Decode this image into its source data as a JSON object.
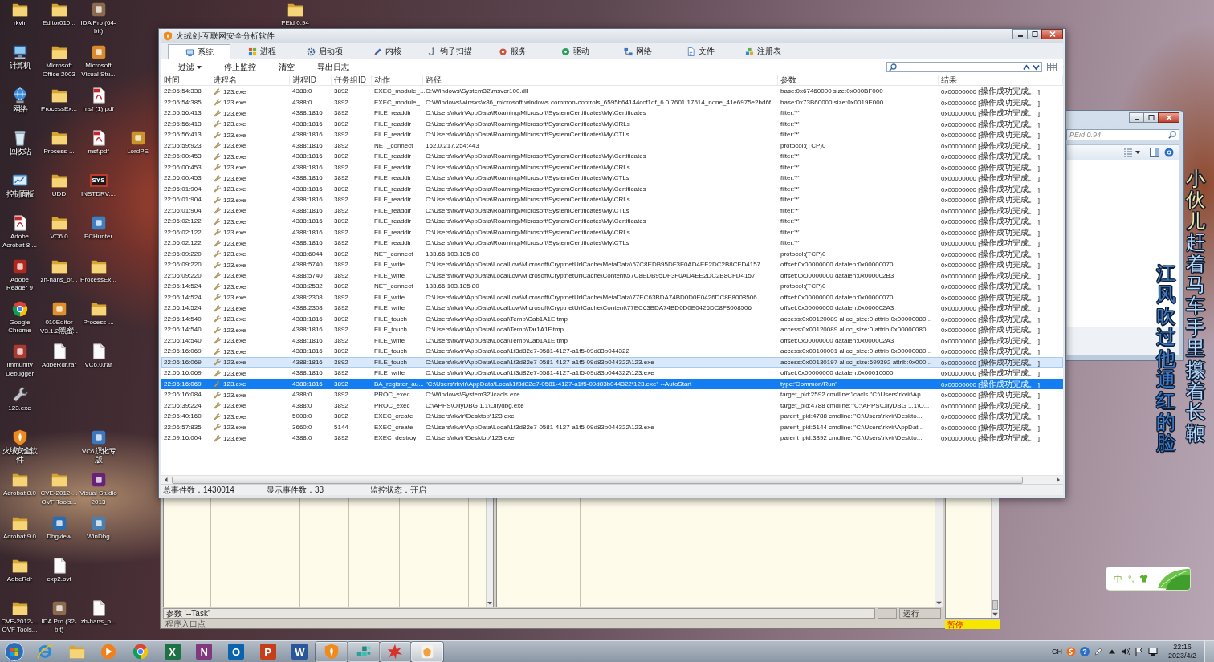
{
  "desktop_icon_rows": [
    [
      {
        "label": "rkvir",
        "kind": "folder"
      },
      {
        "label": "Editor010...",
        "kind": "folder"
      },
      {
        "label": "IDA Pro (64-bit)",
        "kind": "app",
        "color": "#8b6b4e"
      },
      null,
      null,
      null,
      null,
      {
        "label": "PEid 0.94",
        "kind": "folder"
      }
    ],
    [
      {
        "label": "计算机",
        "kind": "computer"
      },
      {
        "label": "Microsoft Office 2003",
        "kind": "folder"
      },
      {
        "label": "Microsoft Visual Stu...",
        "kind": "app",
        "color": "#d8892c"
      }
    ],
    [
      {
        "label": "网络",
        "kind": "network"
      },
      {
        "label": "ProcessEx...",
        "kind": "folder"
      },
      {
        "label": "msf (1).pdf",
        "kind": "pdf"
      }
    ],
    [
      {
        "label": "回收站",
        "kind": "trash"
      },
      {
        "label": "Process-...",
        "kind": "folder"
      },
      {
        "label": "msf.pdf",
        "kind": "pdf"
      },
      {
        "label": "LordPE",
        "kind": "app",
        "color": "#c9952a"
      }
    ],
    [
      {
        "label": "控制面板",
        "kind": "panel"
      },
      {
        "label": "UDD",
        "kind": "folder"
      },
      {
        "label": "INSTDRV....",
        "kind": "sys",
        "badge": "SYS"
      }
    ],
    [
      {
        "label": "Adobe Acrobat 8 ...",
        "kind": "pdf"
      },
      {
        "label": "VC6.0",
        "kind": "folder"
      },
      {
        "label": "PCHunter",
        "kind": "app",
        "color": "#3d7fc1"
      }
    ],
    [
      {
        "label": "Adobe Reader 9",
        "kind": "app",
        "color": "#b3261e"
      },
      {
        "label": "zh-hans_of...",
        "kind": "folder"
      },
      {
        "label": "ProcessEx...",
        "kind": "folder"
      }
    ],
    [
      {
        "label": "Google Chrome",
        "kind": "chrome"
      },
      {
        "label": "010Editor V3.1.2黑蜜...",
        "kind": "app",
        "color": "#e0902a"
      },
      {
        "label": "Process-...",
        "kind": "folder"
      }
    ],
    [
      {
        "label": "Immunity Debugger",
        "kind": "app",
        "color": "#a83a32"
      },
      {
        "label": "AdbeRdr.rar",
        "kind": "file"
      },
      {
        "label": "VC6.0.rar",
        "kind": "file"
      }
    ],
    [
      {
        "label": "123.exe",
        "kind": "wrench"
      }
    ],
    [
      {
        "label": "火绒安全软件",
        "kind": "shield"
      },
      null,
      {
        "label": "VC6汉化专版",
        "kind": "app",
        "color": "#3a78c0"
      }
    ],
    [
      {
        "label": "Acrobat 8.0",
        "kind": "folder"
      },
      {
        "label": "CVE-2012-... OVF Tools...",
        "kind": "folder"
      },
      {
        "label": "Visual Studio 2013",
        "kind": "app",
        "color": "#68217a"
      }
    ],
    [
      {
        "label": "Acrobat 9.0",
        "kind": "folder"
      },
      {
        "label": "Dbgview",
        "kind": "app",
        "color": "#2b6cb0"
      },
      {
        "label": "WinDbg",
        "kind": "app",
        "color": "#4a7fb0"
      }
    ],
    [
      {
        "label": "AdbeRdr",
        "kind": "folder"
      },
      {
        "label": "exp2.ovf",
        "kind": "file"
      }
    ],
    [
      {
        "label": "CVE-2012-... OVF Tools...",
        "kind": "folder"
      },
      {
        "label": "IDA Pro (32-bit)",
        "kind": "app",
        "color": "#8b6b4e"
      },
      {
        "label": "zh-hans_o...",
        "kind": "file"
      }
    ]
  ],
  "main_window": {
    "title": "火绒剑-互联网安全分析软件",
    "tabs": [
      {
        "label": "系统",
        "kind": "monitor",
        "selected": true
      },
      {
        "label": "进程",
        "kind": "flag",
        "selected": false
      },
      {
        "label": "启动项",
        "kind": "gear",
        "selected": false
      },
      {
        "label": "内核",
        "kind": "pen",
        "selected": false
      },
      {
        "label": "钩子扫描",
        "kind": "hook",
        "selected": false
      },
      {
        "label": "服务",
        "kind": "service",
        "selected": false
      },
      {
        "label": "驱动",
        "kind": "disc",
        "selected": false
      },
      {
        "label": "网络",
        "kind": "network",
        "selected": false
      },
      {
        "label": "文件",
        "kind": "file",
        "selected": false
      },
      {
        "label": "注册表",
        "kind": "registry",
        "selected": false
      }
    ],
    "toolbar": {
      "filter": "过滤",
      "buttons": [
        "停止监控",
        "清空",
        "导出日志"
      ]
    },
    "columns": [
      "时间",
      "进程名",
      "进程ID",
      "任务组ID",
      "动作",
      "路径",
      "参数",
      "结果"
    ],
    "rows": [
      {
        "time": "22:05:54:338",
        "process": "123.exe",
        "pid": "4388:0",
        "task_group_id": "3892",
        "action": "EXEC_module_...",
        "path": "C:\\Windows\\System32\\msvcr100.dll",
        "params": "base:0x67460000 size:0x000BF000",
        "result": "0x00000000 [操作成功完成。 ]",
        "selected": false,
        "hovered": false
      },
      {
        "time": "22:05:54:385",
        "process": "123.exe",
        "pid": "4388:0",
        "task_group_id": "3892",
        "action": "EXEC_module_...",
        "path": "C:\\Windows\\winsxs\\x86_microsoft.windows.common-controls_6595b64144ccf1df_6.0.7601.17514_none_41e6975e2bd6f...",
        "params": "base:0x73B60000 size:0x0019E000",
        "result": "0x00000000 [操作成功完成。 ]",
        "selected": false,
        "hovered": false
      },
      {
        "time": "22:05:56:413",
        "process": "123.exe",
        "pid": "4388:1816",
        "task_group_id": "3892",
        "action": "FILE_readdir",
        "path": "C:\\Users\\rkvir\\AppData\\Roaming\\Microsoft\\SystemCertificates\\My\\Certificates",
        "params": "filter:'*'",
        "result": "0x00000000 [操作成功完成。 ]",
        "selected": false,
        "hovered": false
      },
      {
        "time": "22:05:56:413",
        "process": "123.exe",
        "pid": "4388:1816",
        "task_group_id": "3892",
        "action": "FILE_readdir",
        "path": "C:\\Users\\rkvir\\AppData\\Roaming\\Microsoft\\SystemCertificates\\My\\CRLs",
        "params": "filter:'*'",
        "result": "0x00000000 [操作成功完成。 ]",
        "selected": false,
        "hovered": false
      },
      {
        "time": "22:05:56:413",
        "process": "123.exe",
        "pid": "4388:1816",
        "task_group_id": "3892",
        "action": "FILE_readdir",
        "path": "C:\\Users\\rkvir\\AppData\\Roaming\\Microsoft\\SystemCertificates\\My\\CTLs",
        "params": "filter:'*'",
        "result": "0x00000000 [操作成功完成。 ]",
        "selected": false,
        "hovered": false
      },
      {
        "time": "22:05:59:923",
        "process": "123.exe",
        "pid": "4388:1816",
        "task_group_id": "3892",
        "action": "NET_connect",
        "path": "162.0.217.254:443",
        "params": "protocol:(TCP)0",
        "result": "0x00000000 [操作成功完成。 ]",
        "selected": false,
        "hovered": false
      },
      {
        "time": "22:06:00:453",
        "process": "123.exe",
        "pid": "4388:1816",
        "task_group_id": "3892",
        "action": "FILE_readdir",
        "path": "C:\\Users\\rkvir\\AppData\\Roaming\\Microsoft\\SystemCertificates\\My\\Certificates",
        "params": "filter:'*'",
        "result": "0x00000000 [操作成功完成。 ]",
        "selected": false,
        "hovered": false
      },
      {
        "time": "22:06:00:453",
        "process": "123.exe",
        "pid": "4388:1816",
        "task_group_id": "3892",
        "action": "FILE_readdir",
        "path": "C:\\Users\\rkvir\\AppData\\Roaming\\Microsoft\\SystemCertificates\\My\\CRLs",
        "params": "filter:'*'",
        "result": "0x00000000 [操作成功完成。 ]",
        "selected": false,
        "hovered": false
      },
      {
        "time": "22:06:00:453",
        "process": "123.exe",
        "pid": "4388:1816",
        "task_group_id": "3892",
        "action": "FILE_readdir",
        "path": "C:\\Users\\rkvir\\AppData\\Roaming\\Microsoft\\SystemCertificates\\My\\CTLs",
        "params": "filter:'*'",
        "result": "0x00000000 [操作成功完成。 ]",
        "selected": false,
        "hovered": false
      },
      {
        "time": "22:06:01:904",
        "process": "123.exe",
        "pid": "4388:1816",
        "task_group_id": "3892",
        "action": "FILE_readdir",
        "path": "C:\\Users\\rkvir\\AppData\\Roaming\\Microsoft\\SystemCertificates\\My\\Certificates",
        "params": "filter:'*'",
        "result": "0x00000000 [操作成功完成。 ]",
        "selected": false,
        "hovered": false
      },
      {
        "time": "22:06:01:904",
        "process": "123.exe",
        "pid": "4388:1816",
        "task_group_id": "3892",
        "action": "FILE_readdir",
        "path": "C:\\Users\\rkvir\\AppData\\Roaming\\Microsoft\\SystemCertificates\\My\\CRLs",
        "params": "filter:'*'",
        "result": "0x00000000 [操作成功完成。 ]",
        "selected": false,
        "hovered": false
      },
      {
        "time": "22:06:01:904",
        "process": "123.exe",
        "pid": "4388:1816",
        "task_group_id": "3892",
        "action": "FILE_readdir",
        "path": "C:\\Users\\rkvir\\AppData\\Roaming\\Microsoft\\SystemCertificates\\My\\CTLs",
        "params": "filter:'*'",
        "result": "0x00000000 [操作成功完成。 ]",
        "selected": false,
        "hovered": false
      },
      {
        "time": "22:06:02:122",
        "process": "123.exe",
        "pid": "4388:1816",
        "task_group_id": "3892",
        "action": "FILE_readdir",
        "path": "C:\\Users\\rkvir\\AppData\\Roaming\\Microsoft\\SystemCertificates\\My\\Certificates",
        "params": "filter:'*'",
        "result": "0x00000000 [操作成功完成。 ]",
        "selected": false,
        "hovered": false
      },
      {
        "time": "22:06:02:122",
        "process": "123.exe",
        "pid": "4388:1816",
        "task_group_id": "3892",
        "action": "FILE_readdir",
        "path": "C:\\Users\\rkvir\\AppData\\Roaming\\Microsoft\\SystemCertificates\\My\\CRLs",
        "params": "filter:'*'",
        "result": "0x00000000 [操作成功完成。 ]",
        "selected": false,
        "hovered": false
      },
      {
        "time": "22:06:02:122",
        "process": "123.exe",
        "pid": "4388:1816",
        "task_group_id": "3892",
        "action": "FILE_readdir",
        "path": "C:\\Users\\rkvir\\AppData\\Roaming\\Microsoft\\SystemCertificates\\My\\CTLs",
        "params": "filter:'*'",
        "result": "0x00000000 [操作成功完成。 ]",
        "selected": false,
        "hovered": false
      },
      {
        "time": "22:06:09:220",
        "process": "123.exe",
        "pid": "4388:6044",
        "task_group_id": "3892",
        "action": "NET_connect",
        "path": "183.66.103.185:80",
        "params": "protocol:(TCP)0",
        "result": "0x00000000 [操作成功完成。 ]",
        "selected": false,
        "hovered": false
      },
      {
        "time": "22:06:09:220",
        "process": "123.exe",
        "pid": "4388:5740",
        "task_group_id": "3892",
        "action": "FILE_write",
        "path": "C:\\Users\\rkvir\\AppData\\LocalLow\\Microsoft\\CryptnetUrlCache\\MetaData\\57C8EDB95DF3F0AD4EE2DC2B8CFD4157",
        "params": "offset:0x00000000 datalen:0x00000070",
        "result": "0x00000000 [操作成功完成。 ]",
        "selected": false,
        "hovered": false
      },
      {
        "time": "22:06:09:220",
        "process": "123.exe",
        "pid": "4388:5740",
        "task_group_id": "3892",
        "action": "FILE_write",
        "path": "C:\\Users\\rkvir\\AppData\\LocalLow\\Microsoft\\CryptnetUrlCache\\Content\\57C8EDB95DF3F0AD4EE2DC2B8CFD4157",
        "params": "offset:0x00000000 datalen:0x000002B3",
        "result": "0x00000000 [操作成功完成。 ]",
        "selected": false,
        "hovered": false
      },
      {
        "time": "22:06:14:524",
        "process": "123.exe",
        "pid": "4388:2532",
        "task_group_id": "3892",
        "action": "NET_connect",
        "path": "183.66.103.185:80",
        "params": "protocol:(TCP)0",
        "result": "0x00000000 [操作成功完成。 ]",
        "selected": false,
        "hovered": false
      },
      {
        "time": "22:06:14:524",
        "process": "123.exe",
        "pid": "4388:2308",
        "task_group_id": "3892",
        "action": "FILE_write",
        "path": "C:\\Users\\rkvir\\AppData\\LocalLow\\Microsoft\\CryptnetUrlCache\\MetaData\\77EC63BDA74BD0D0E0426DC8F8008506",
        "params": "offset:0x00000000 datalen:0x00000070",
        "result": "0x00000000 [操作成功完成。 ]",
        "selected": false,
        "hovered": false
      },
      {
        "time": "22:06:14:524",
        "process": "123.exe",
        "pid": "4388:2308",
        "task_group_id": "3892",
        "action": "FILE_write",
        "path": "C:\\Users\\rkvir\\AppData\\LocalLow\\Microsoft\\CryptnetUrlCache\\Content\\77EC63BDA74BD0D0E0426DC8F8008506",
        "params": "offset:0x00000000 datalen:0x000002A3",
        "result": "0x00000000 [操作成功完成。 ]",
        "selected": false,
        "hovered": false
      },
      {
        "time": "22:06:14:540",
        "process": "123.exe",
        "pid": "4388:1816",
        "task_group_id": "3892",
        "action": "FILE_touch",
        "path": "C:\\Users\\rkvir\\AppData\\Local\\Temp\\Cab1A1E.tmp",
        "params": "access:0x00120089 alloc_size:0 attrib:0x00000080...",
        "result": "0x00000000 [操作成功完成。 ]",
        "selected": false,
        "hovered": false
      },
      {
        "time": "22:06:14:540",
        "process": "123.exe",
        "pid": "4388:1816",
        "task_group_id": "3892",
        "action": "FILE_touch",
        "path": "C:\\Users\\rkvir\\AppData\\Local\\Temp\\Tar1A1F.tmp",
        "params": "access:0x00120089 alloc_size:0 attrib:0x00000080...",
        "result": "0x00000000 [操作成功完成。 ]",
        "selected": false,
        "hovered": false
      },
      {
        "time": "22:06:14:540",
        "process": "123.exe",
        "pid": "4388:1816",
        "task_group_id": "3892",
        "action": "FILE_write",
        "path": "C:\\Users\\rkvir\\AppData\\Local\\Temp\\Cab1A1E.tmp",
        "params": "offset:0x00000000 datalen:0x000002A3",
        "result": "0x00000000 [操作成功完成。 ]",
        "selected": false,
        "hovered": false
      },
      {
        "time": "22:06:16:069",
        "process": "123.exe",
        "pid": "4388:1816",
        "task_group_id": "3892",
        "action": "FILE_touch",
        "path": "C:\\Users\\rkvir\\AppData\\Local\\1f3d82e7-0581-4127-a1f5-09d83b044322",
        "params": "access:0x00100001 alloc_size:0 attrib:0x00000080...",
        "result": "0x00000000 [操作成功完成。 ]",
        "selected": false,
        "hovered": false
      },
      {
        "time": "22:06:16:069",
        "process": "123.exe",
        "pid": "4388:1816",
        "task_group_id": "3892",
        "action": "FILE_touch",
        "path": "C:\\Users\\rkvir\\AppData\\Local\\1f3d82e7-0581-4127-a1f5-09d83b044322\\123.exe",
        "params": "access:0x00130197 alloc_size:699392 attrib:0x000...",
        "result": "0x00000000 [操作成功完成。 ]",
        "selected": false,
        "hovered": true
      },
      {
        "time": "22:06:16:069",
        "process": "123.exe",
        "pid": "4388:1816",
        "task_group_id": "3892",
        "action": "FILE_write",
        "path": "C:\\Users\\rkvir\\AppData\\Local\\1f3d82e7-0581-4127-a1f5-09d83b044322\\123.exe",
        "params": "offset:0x00000000 datalen:0x00010000",
        "result": "0x00000000 [操作成功完成。 ]",
        "selected": false,
        "hovered": false
      },
      {
        "time": "22:06:16:069",
        "process": "123.exe",
        "pid": "4388:1816",
        "task_group_id": "3892",
        "action": "BA_register_au...",
        "path": "\"C:\\Users\\rkvir\\AppData\\Local\\1f3d82e7-0581-4127-a1f5-09d83b044322\\123.exe\" --AutoStart",
        "params": "type:'Common/Run'",
        "result": "0x00000000 [操作成功完成。 ]",
        "selected": true,
        "hovered": false
      },
      {
        "time": "22:06:16:084",
        "process": "123.exe",
        "pid": "4388:0",
        "task_group_id": "3892",
        "action": "PROC_exec",
        "path": "C:\\Windows\\System32\\icacls.exe",
        "params": "target_pid:2592 cmdline:'icacls \"C:\\Users\\rkvir\\Ap...",
        "result": "0x00000000 [操作成功完成。 ]",
        "selected": false,
        "hovered": false
      },
      {
        "time": "22:06:39:224",
        "process": "123.exe",
        "pid": "4388:0",
        "task_group_id": "3892",
        "action": "PROC_exec",
        "path": "C:\\APPS\\OllyDBG 1.1\\Ollydbg.exe",
        "params": "target_pid:4788 cmdline:'\"C:\\APPS\\OllyDBG 1.1\\O...",
        "result": "0x00000000 [操作成功完成。 ]",
        "selected": false,
        "hovered": false
      },
      {
        "time": "22:06:40:160",
        "process": "123.exe",
        "pid": "5008:0",
        "task_group_id": "3892",
        "action": "EXEC_create",
        "path": "C:\\Users\\rkvir\\Desktop\\123.exe",
        "params": "parent_pid:4788 cmdline:'\"C:\\Users\\rkvir\\Deskto...",
        "result": "0x00000000 [操作成功完成。 ]",
        "selected": false,
        "hovered": false
      },
      {
        "time": "22:06:57:835",
        "process": "123.exe",
        "pid": "3660:0",
        "task_group_id": "5144",
        "action": "EXEC_create",
        "path": "C:\\Users\\rkvir\\AppData\\Local\\1f3d82e7-0581-4127-a1f5-09d83b044322\\123.exe",
        "params": "parent_pid:5144 cmdline:'\"C:\\Users\\rkvir\\AppDat...",
        "result": "0x00000000 [操作成功完成。 ]",
        "selected": false,
        "hovered": false
      },
      {
        "time": "22:09:16:004",
        "process": "123.exe",
        "pid": "4388:0",
        "task_group_id": "3892",
        "action": "EXEC_destroy",
        "path": "C:\\Users\\rkvir\\Desktop\\123.exe",
        "params": "parent_pid:3892 cmdline:'\"C:\\Users\\rkvir\\Deskto...",
        "result": "0x00000000 [操作成功完成。 ]",
        "selected": false,
        "hovered": false
      }
    ],
    "status_bar": [
      "总事件数：1430014",
      "显示事件数：33",
      "监控状态：开启"
    ]
  },
  "debugger_window": {
    "command_line": "参数 '--Task'",
    "run_state": "运行",
    "status_message": "程序入口点",
    "pause_label": "暂停"
  },
  "explorer_window": {
    "search": {
      "placeholder": "PEid 0.94"
    }
  },
  "lyrics": [
    {
      "text": "**小伙儿**赶着马车手里攥着长鞭"
    },
    {
      "text": "江风吹过他通红的脸"
    }
  ],
  "ime_bar": {
    "mode": "中",
    "punctuation": "°,"
  },
  "taskbar": {
    "apps": [
      {
        "kind": "ie",
        "running": false,
        "selected": false
      },
      {
        "kind": "folder",
        "running": false,
        "selected": false
      },
      {
        "kind": "media",
        "running": false,
        "selected": false
      },
      {
        "kind": "chrome",
        "running": false,
        "selected": false
      },
      {
        "kind": "letter",
        "glyph": "X",
        "color": "#1e7145",
        "running": false,
        "selected": false
      },
      {
        "kind": "letter",
        "glyph": "N",
        "color": "#80397b",
        "running": false,
        "selected": false
      },
      {
        "kind": "letter",
        "glyph": "O",
        "color": "#0a64ad",
        "running": false,
        "selected": false
      },
      {
        "kind": "letter",
        "glyph": "P",
        "color": "#c43e1c",
        "running": false,
        "selected": false
      },
      {
        "kind": "letter",
        "glyph": "W",
        "color": "#2b579a",
        "running": false,
        "selected": false
      },
      {
        "kind": "shield",
        "running": true,
        "selected": false
      },
      {
        "kind": "tiles",
        "running": true,
        "selected": false
      },
      {
        "kind": "splat",
        "running": true,
        "selected": false
      },
      {
        "kind": "app",
        "running": true,
        "selected": true
      }
    ],
    "tray": {
      "language": "CH",
      "help": "?",
      "time": "22:16",
      "date": "2023/4/2"
    }
  }
}
